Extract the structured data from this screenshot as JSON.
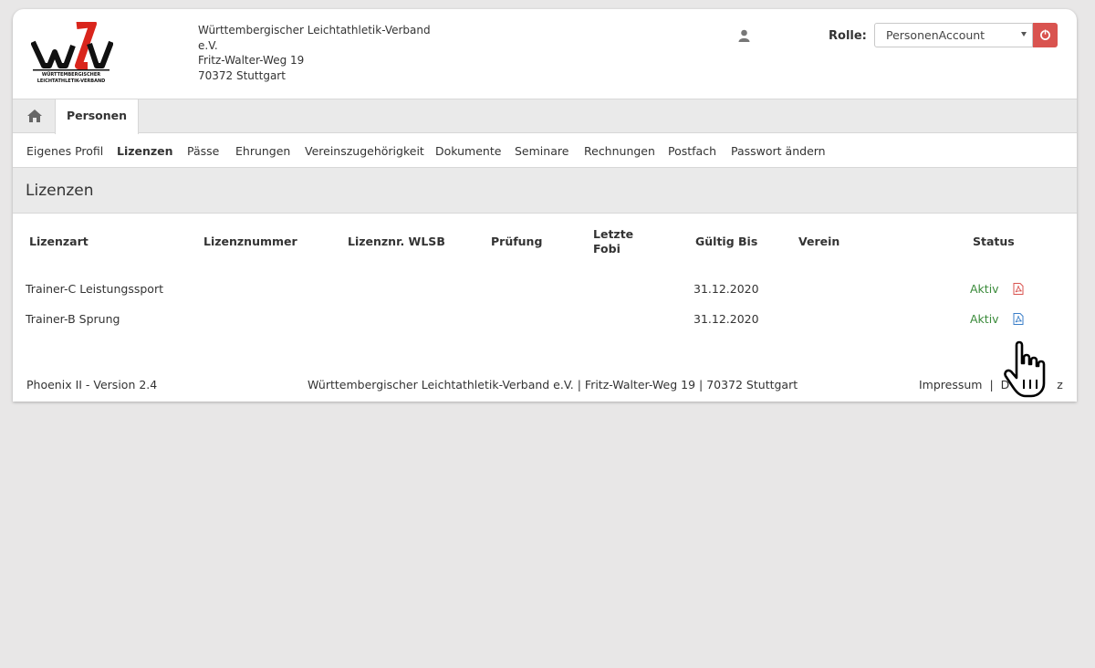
{
  "header": {
    "org_name": "Württembergischer Leichtathletik-Verband",
    "org_suffix": "e.V.",
    "street": "Fritz-Walter-Weg 19",
    "city": "70372 Stuttgart",
    "logo_text": "wlv",
    "logo_subtitle_1": "WÜRTTEMBERGISCHER",
    "logo_subtitle_2": "LEICHTATHLETIK-VERBAND",
    "role_label": "Rolle:",
    "role_value": "PersonenAccount",
    "user_icon": "user-icon",
    "logout_icon": "power-icon"
  },
  "tabs": {
    "home_icon": "home-icon",
    "active_tab": "Personen"
  },
  "subnav": {
    "items": [
      "Eigenes Profil",
      "Lizenzen",
      "Pässe",
      "Ehrungen",
      "Vereinszugehörigkeit",
      "Dokumente",
      "Seminare",
      "Rechnungen",
      "Postfach",
      "Passwort ändern"
    ],
    "active": "Lizenzen"
  },
  "page": {
    "title": "Lizenzen"
  },
  "table": {
    "headers": {
      "lizenzart": "Lizenzart",
      "lizenznummer": "Lizenznummer",
      "lizenznr_wlsb": "Lizenznr. WLSB",
      "pruefung": "Prüfung",
      "letzte_fobi_1": "Letzte",
      "letzte_fobi_2": "Fobi",
      "gueltig_bis": "Gültig Bis",
      "verein": "Verein",
      "status": "Status"
    },
    "rows": [
      {
        "lizenzart": "Trainer-C Leistungssport",
        "lizenznummer": "",
        "lizenznr_wlsb": "",
        "pruefung": "",
        "letzte_fobi": "",
        "gueltig_bis": "31.12.2020",
        "verein": "",
        "status": "Aktiv",
        "icon": "pdf-icon",
        "icon_color": "#d9534f"
      },
      {
        "lizenzart": "Trainer-B Sprung",
        "lizenznummer": "",
        "lizenznr_wlsb": "",
        "pruefung": "",
        "letzte_fobi": "",
        "gueltig_bis": "31.12.2020",
        "verein": "",
        "status": "Aktiv",
        "icon": "pdf-icon",
        "icon_color": "#3a7ec8"
      }
    ]
  },
  "footer": {
    "version": "Phoenix II - Version 2.4",
    "address": "Württembergischer Leichtathletik-Verband e.V. | Fritz-Walter-Weg 19 | 70372 Stuttgart",
    "impressum": "Impressum",
    "separator": "|",
    "partial_left": "D",
    "partial_right": "z"
  },
  "colors": {
    "status_active": "#3a8a3a",
    "logout_button": "#d9534f",
    "logo_red": "#d9251c"
  }
}
